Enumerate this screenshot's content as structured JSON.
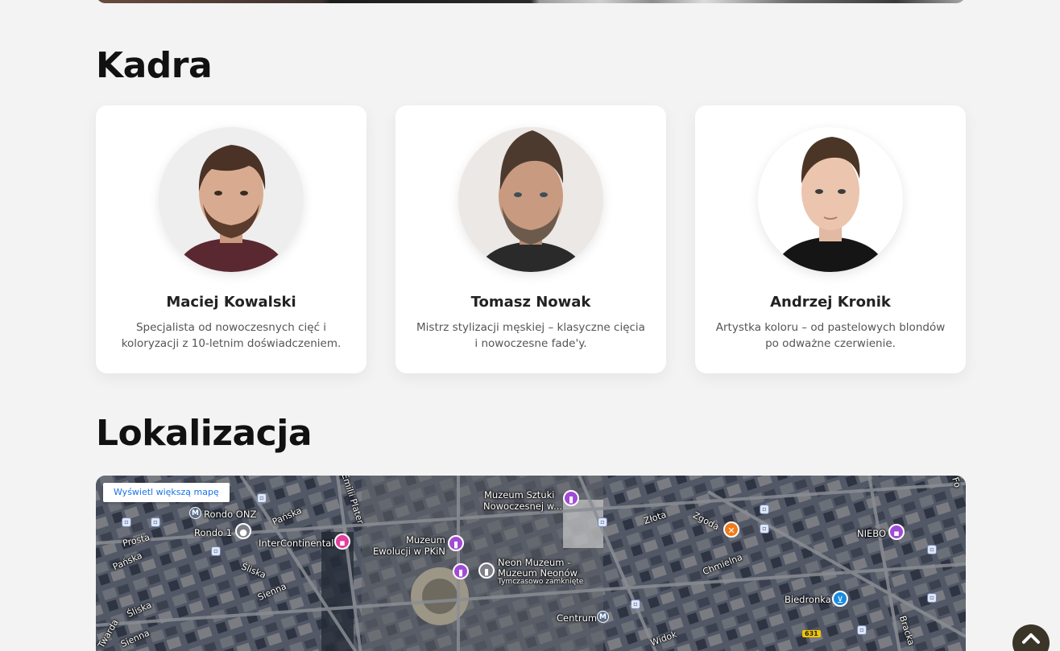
{
  "sections": {
    "team_title": "Kadra",
    "location_title": "Lokalizacja"
  },
  "team": [
    {
      "name": "Maciej Kowalski",
      "description": "Specjalista od nowoczesnych cięć i koloryzacji z 10-letnim doświadczeniem."
    },
    {
      "name": "Tomasz Nowak",
      "description": "Mistrz stylizacji męskiej – klasyczne cięcia i nowoczesne fade'y."
    },
    {
      "name": "Andrzej Kronik",
      "description": "Artystka koloru – od pastelowych blondów po odważne czerwienie."
    }
  ],
  "map": {
    "larger_map_button": "Wyświetl większą mapę",
    "places": {
      "rondo_onz": "Rondo ONZ",
      "rondo_1": "Rondo 1",
      "intercontinental": "InterContinental",
      "muzeum_sztuki": "Muzeum Sztuki",
      "muzeum_sztuki_2": "Nowoczesnej w...",
      "muzeum_ewolucji": "Muzeum",
      "muzeum_ewolucji_2": "Ewolucji w PKiN",
      "neon_muzeum": "Neon Muzeum -",
      "neon_muzeum_2": "Muzeum Neonów",
      "neon_muzeum_3": "Tymczasowo zamknięte",
      "niebo": "NIEBO",
      "biedronka": "Biedronka",
      "centrum": "Centrum",
      "widok": "Widok"
    },
    "streets": {
      "emilii_plater": "Emilii Plater",
      "panska": "Pańska",
      "panska_2": "Pańska",
      "prosta": "Prosta",
      "sliska": "Śliska",
      "sliska_2": "Śliska",
      "sienna": "Sienna",
      "sienna_2": "Sienna",
      "twarda": "Twarda",
      "zlota": "Złota",
      "zgoda": "Zgoda",
      "chmielna": "Chmielna",
      "bracka": "Bracka",
      "fo": "Fo",
      "road_631": "631"
    }
  },
  "scroll_top": {
    "icon": "chevron-up-icon",
    "color": "#3b3528"
  }
}
